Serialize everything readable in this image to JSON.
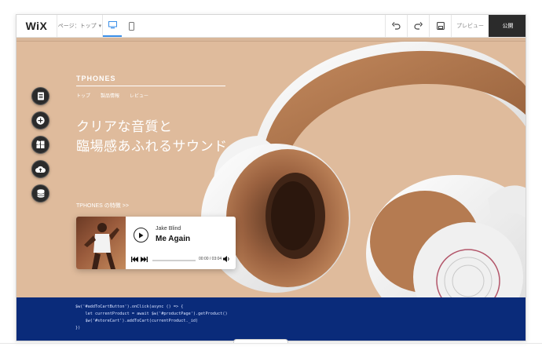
{
  "editor": {
    "logo": "WiX",
    "page_select": "ページ：トップ",
    "preview_label": "プレビュー",
    "publish_label": "公開"
  },
  "site": {
    "brand": "TPHONES",
    "nav": [
      "トップ",
      "製品情報",
      "レビュー"
    ],
    "headline_line1": "クリアな音質と",
    "headline_line2": "臨場感あふれるサウンド",
    "feature_link": "TPHONES の特徴 >>"
  },
  "player": {
    "artist": "Jake Blind",
    "song": "Me Again",
    "time": "00:00 / 03:04"
  },
  "code": {
    "lines": [
      "$w('#addToCartButton').onClick(async () => {",
      "    let currentProduct = await $w('#productPage').getProduct()",
      "    $w('#storeCart').addToCart(currentProduct._id)",
      "})"
    ]
  },
  "colors": {
    "hero_bg": "#dfbb9c",
    "code_bg": "#0a2b7a",
    "publish_bg": "#2b2b2b",
    "active_device": "#3b8fe8"
  },
  "icons": {
    "tools": [
      "pages-icon",
      "add-icon",
      "app-market-icon",
      "upload-icon",
      "database-icon"
    ]
  }
}
